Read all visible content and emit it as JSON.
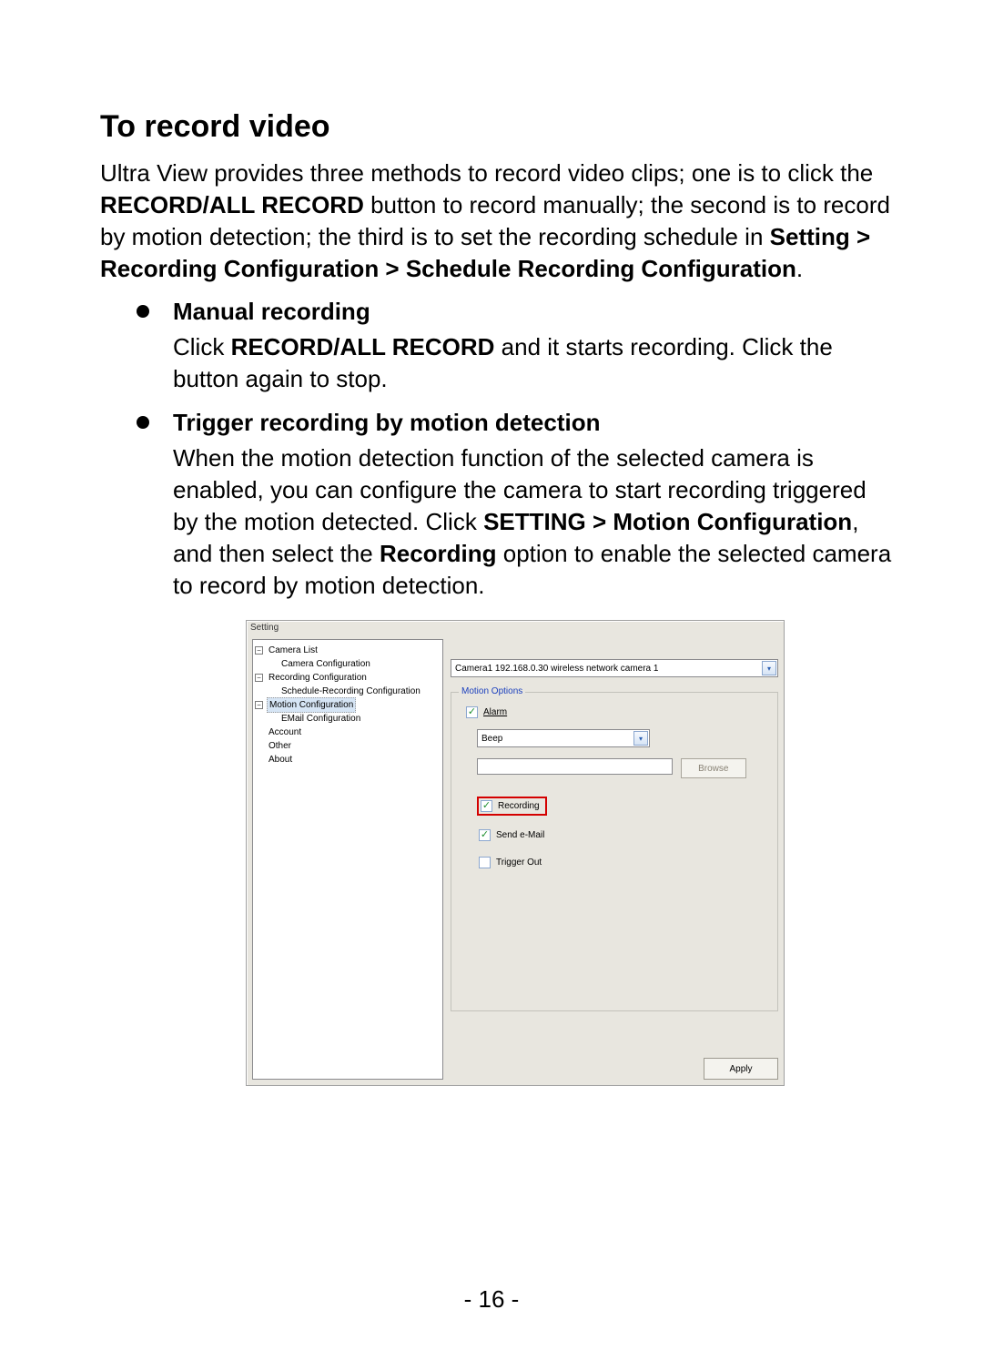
{
  "title": "To record video",
  "intro_parts": {
    "p1_a": "Ultra View provides three methods to record video clips; one is to click the ",
    "p1_b": "RECORD/ALL RECORD",
    "p1_c": " button to record manually; the second is to record by motion detection; the third is to set the recording schedule in ",
    "p1_d": "Setting > Recording Configuration > Schedule Recording Configuration",
    "p1_e": "."
  },
  "manual": {
    "heading": "Manual recording",
    "body_a": "Click ",
    "body_b": "RECORD/ALL RECORD",
    "body_c": " and it starts recording. Click the button again to stop."
  },
  "trigger": {
    "heading": "Trigger recording by motion detection",
    "body_a": "When the motion detection function of the selected camera is enabled, you can configure the camera to start recording triggered by the motion detected. Click ",
    "body_b": "SETTING > Motion Configuration",
    "body_c": ", and then select the ",
    "body_d": "Recording",
    "body_e": " option to enable the selected camera to record by motion detection."
  },
  "screenshot": {
    "window_title": "Setting",
    "tree": {
      "n0": "Camera List",
      "n0a": "Camera Configuration",
      "n1": "Recording Configuration",
      "n1a": "Schedule-Recording Configuration",
      "n2": "Motion Configuration",
      "n2a": "EMail Configuration",
      "n3": "Account",
      "n4": "Other",
      "n5": "About"
    },
    "camera_dropdown": "Camera1 192.168.0.30 wireless network camera 1",
    "motion_legend": "Motion Options",
    "alarm_label": "Alarm",
    "alarm_dropdown": "Beep",
    "browse_button": "Browse",
    "opt_recording": "Recording",
    "opt_sendemail": "Send e-Mail",
    "opt_triggerout": "Trigger Out",
    "apply_button": "Apply"
  },
  "page_number": "- 16 -",
  "glyphs": {
    "minus": "−",
    "chevron": "▾",
    "check": "✓"
  }
}
